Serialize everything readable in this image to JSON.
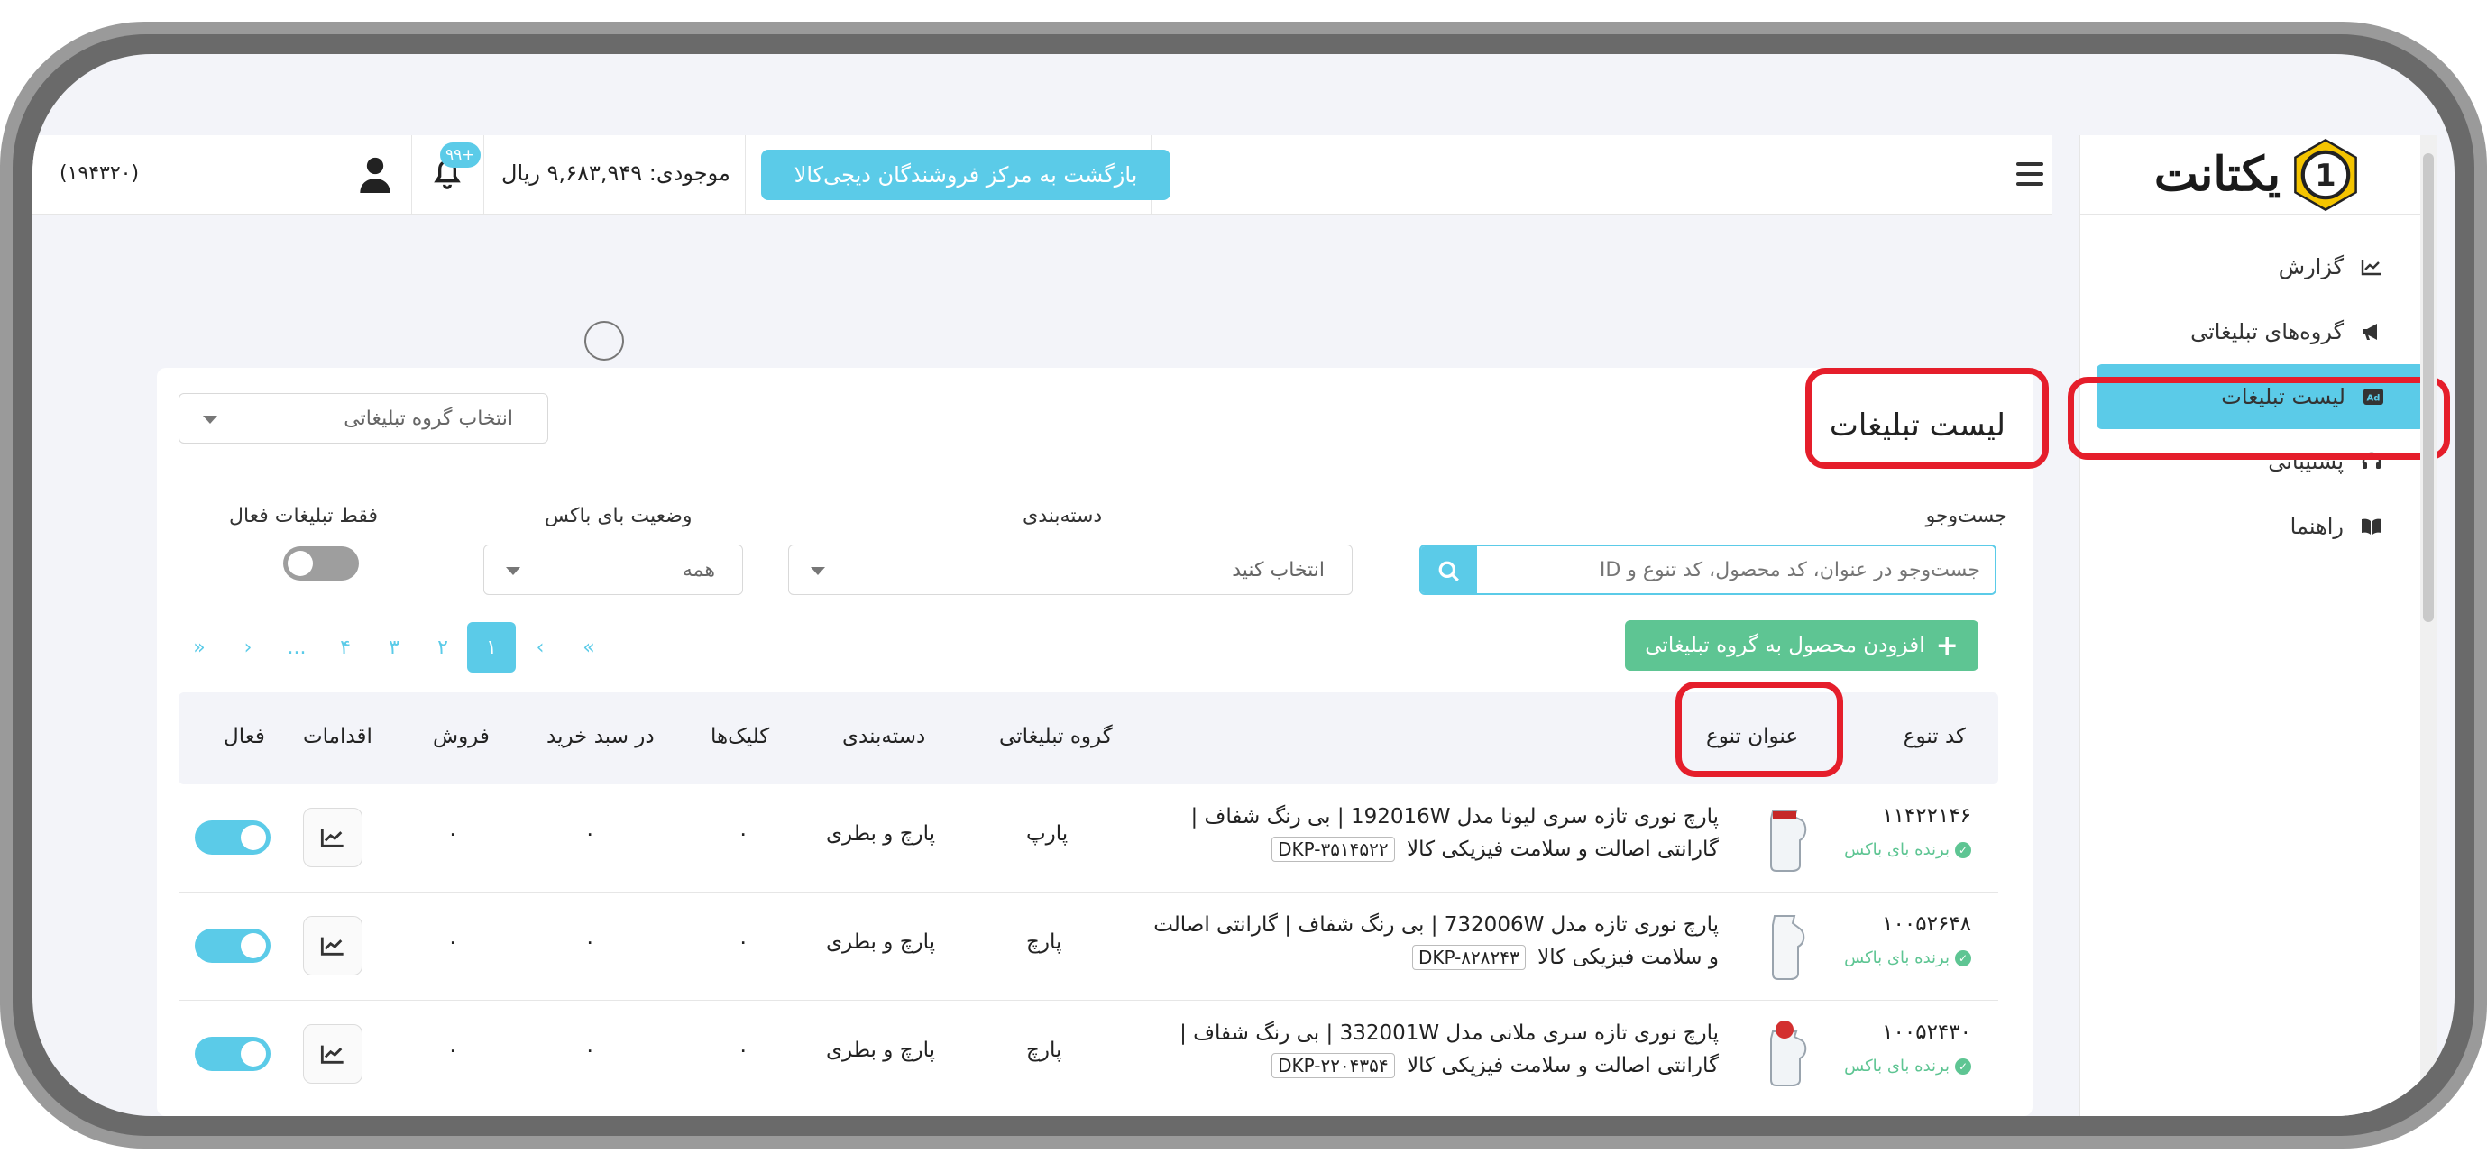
{
  "header": {
    "back_button": "بازگشت به مرکز فروشندگان دیجی‌کالا",
    "balance": "موجودی: ۹,۶۸۳,۹۴۹ ریال",
    "notification_badge": "۹۹+",
    "account_id": "(۱۹۴۳۲۰)"
  },
  "sidebar": {
    "logo_text": "یکتانت",
    "logo_badge_number": "1",
    "items": [
      {
        "label": "گزارش",
        "icon": "chart-icon"
      },
      {
        "label": "گروه‌های تبلیغاتی",
        "icon": "megaphone-icon"
      },
      {
        "label": "لیست تبلیغات",
        "icon": "ad-icon"
      },
      {
        "label": "پشتیبانی",
        "icon": "headset-icon"
      },
      {
        "label": "راهنما",
        "icon": "book-icon"
      }
    ]
  },
  "main": {
    "title": "لیست تبلیغات",
    "group_select_placeholder": "انتخاب گروه تبلیغاتی",
    "filters": {
      "search_label": "جست‌وجو",
      "search_placeholder": "جست‌وجو در عنوان، کد محصول، کد تنوع و ID",
      "category_label": "دسته‌بندی",
      "category_value": "انتخاب کنید",
      "buybox_label": "وضعیت بای باکس",
      "buybox_value": "همه",
      "active_only_label": "فقط تبلیغات فعال"
    },
    "add_button": "افزودن محصول به گروه تبلیغاتی",
    "pagination": {
      "first": "«",
      "prev": "‹",
      "pages": [
        "۱",
        "۲",
        "۳",
        "۴"
      ],
      "ellipsis": "...",
      "next": "›",
      "last": "»"
    },
    "table": {
      "columns": {
        "variant_code": "کد تنوع",
        "variant_title": "عنوان تنوع",
        "ad_group": "گروه تبلیغاتی",
        "category": "دسته‌بندی",
        "clicks": "کلیک‌ها",
        "in_cart": "در سبد خرید",
        "sales": "فروش",
        "actions": "اقدامات",
        "active": "فعال"
      },
      "winner_label": "برنده بای باکس",
      "rows": [
        {
          "code": "۱۱۴۲۲۱۴۶",
          "title": "پارچ نوری تازه سری لیونا مدل 192016W | بی رنگ شفاف | گارانتی اصالت و سلامت فیزیکی کالا",
          "dkp": "DKP-۳۵۱۴۵۲۲",
          "ad_group": "پارپ",
          "category": "پارچ و بطری",
          "clicks": "۰",
          "in_cart": "۰",
          "sales": "۰"
        },
        {
          "code": "۱۰۰۵۲۶۴۸",
          "title": "پارچ نوری تازه مدل 732006W | بی رنگ شفاف | گارانتی اصالت و سلامت فیزیکی کالا",
          "dkp": "DKP-۸۲۸۲۴۳",
          "ad_group": "پارچ",
          "category": "پارچ و بطری",
          "clicks": "۰",
          "in_cart": "۰",
          "sales": "۰"
        },
        {
          "code": "۱۰۰۵۲۴۳۰",
          "title": "پارچ نوری تازه سری ملانی مدل 332001W | بی رنگ شفاف | گارانتی اصالت و سلامت فیزیکی کالا",
          "dkp": "DKP-۲۲۰۴۳۵۴",
          "ad_group": "پارچ",
          "category": "پارچ و بطری",
          "clicks": "۰",
          "in_cart": "۰",
          "sales": "۰"
        }
      ]
    }
  },
  "colors": {
    "accent": "#5bcbe8",
    "success": "#5ec593",
    "highlight": "#e51e2b"
  }
}
